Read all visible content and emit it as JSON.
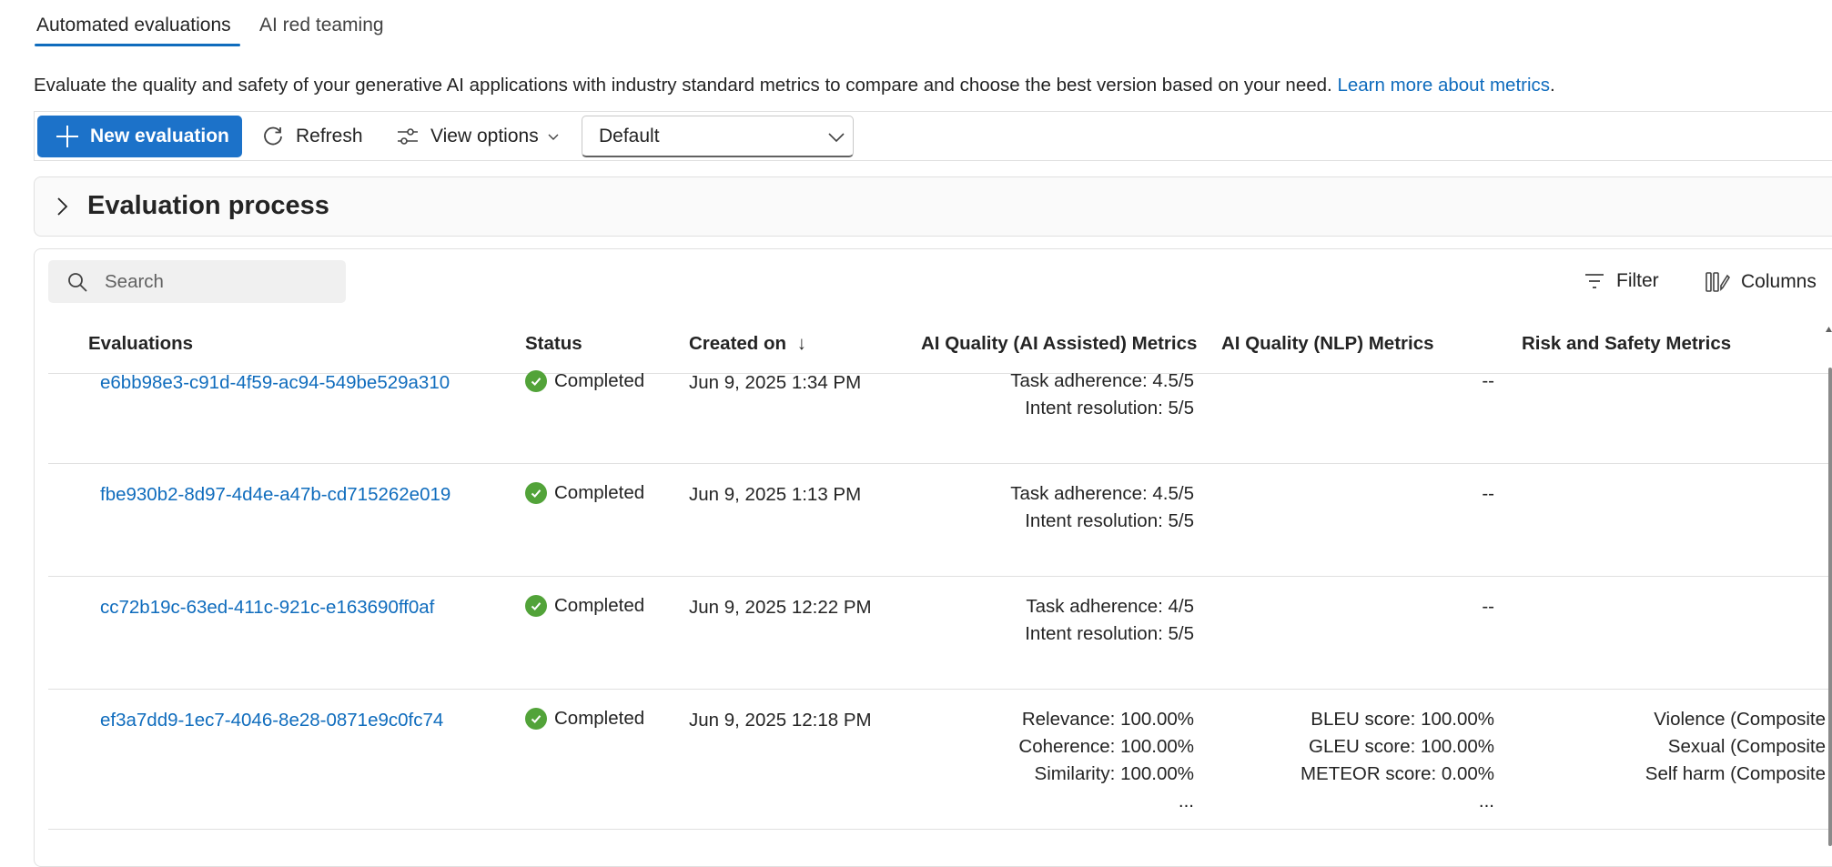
{
  "tabs": [
    {
      "label": "Automated evaluations",
      "active": true
    },
    {
      "label": "AI red teaming",
      "active": false
    }
  ],
  "description": {
    "text": "Evaluate the quality and safety of your generative AI applications with industry standard metrics to compare and choose the best version based on your need.",
    "link": "Learn more about metrics",
    "period": "."
  },
  "toolbar": {
    "new_evaluation": "New evaluation",
    "refresh": "Refresh",
    "view_options": "View options",
    "view_select": "Default"
  },
  "process_card": {
    "title": "Evaluation process"
  },
  "table_tools": {
    "search_placeholder": "Search",
    "filter": "Filter",
    "columns": "Columns"
  },
  "table": {
    "headers": {
      "evaluations": "Evaluations",
      "status": "Status",
      "created_on": "Created on",
      "sort_indicator": "↓",
      "ai_assisted": "AI Quality (AI Assisted) Metrics",
      "nlp": "AI Quality (NLP) Metrics",
      "risk": "Risk and Safety Metrics"
    },
    "rows": [
      {
        "id": "e6bb98e3-c91d-4f59-ac94-549be529a310",
        "status": "Completed",
        "created": "Jun 9, 2025 1:34 PM",
        "ai_assisted": [
          "Task adherence: 4.5/5",
          "Intent resolution: 5/5"
        ],
        "nlp": [
          "--"
        ],
        "risk": []
      },
      {
        "id": "fbe930b2-8d97-4d4e-a47b-cd715262e019",
        "status": "Completed",
        "created": "Jun 9, 2025 1:13 PM",
        "ai_assisted": [
          "Task adherence: 4.5/5",
          "Intent resolution: 5/5"
        ],
        "nlp": [
          "--"
        ],
        "risk": []
      },
      {
        "id": "cc72b19c-63ed-411c-921c-e163690ff0af",
        "status": "Completed",
        "created": "Jun 9, 2025 12:22 PM",
        "ai_assisted": [
          "Task adherence: 4/5",
          "Intent resolution: 5/5"
        ],
        "nlp": [
          "--"
        ],
        "risk": []
      },
      {
        "id": "ef3a7dd9-1ec7-4046-8e28-0871e9c0fc74",
        "status": "Completed",
        "created": "Jun 9, 2025 12:18 PM",
        "ai_assisted": [
          "Relevance: 100.00%",
          "Coherence: 100.00%",
          "Similarity: 100.00%",
          "..."
        ],
        "nlp": [
          "BLEU score: 100.00%",
          "GLEU score: 100.00%",
          "METEOR score: 0.00%",
          "..."
        ],
        "risk": [
          "Violence (Composite",
          "Sexual (Composite",
          "Self harm (Composite"
        ]
      }
    ]
  },
  "colors": {
    "accent": "#0f6cbd",
    "primary_button": "#1c72c9",
    "success": "#52a339"
  }
}
